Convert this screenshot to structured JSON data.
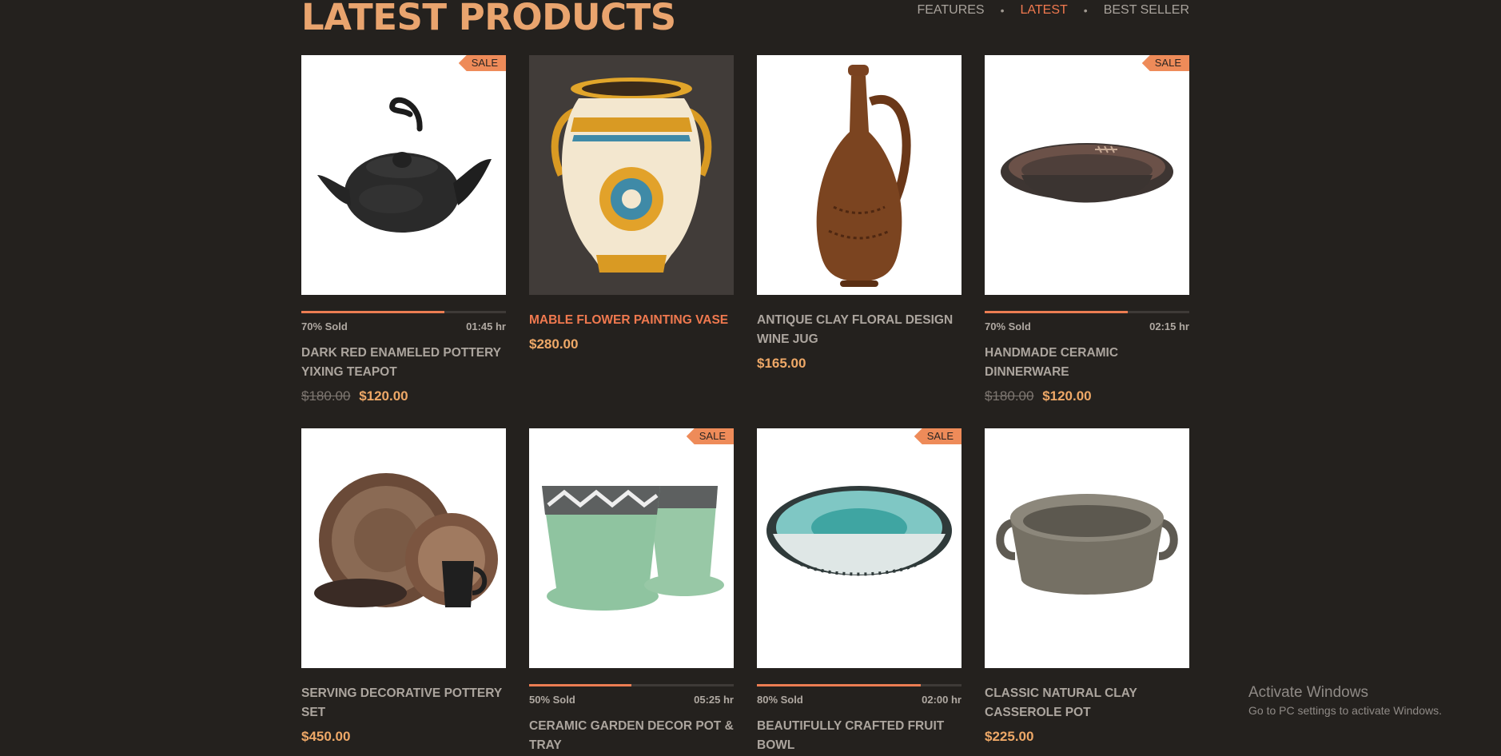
{
  "section": {
    "title": "LATEST PRODUCTS"
  },
  "tabs": [
    {
      "label": "FEATURES"
    },
    {
      "label": "LATEST"
    },
    {
      "label": "BEST SELLER"
    }
  ],
  "products": [
    {
      "name": "DARK RED ENAMELED POTTERY YIXING TEAPOT",
      "old_price": "$180.00",
      "price": "$120.00",
      "badge": "SALE",
      "sold_text": "70% Sold",
      "sold_percent": 70,
      "time_left": "01:45 hr",
      "image": "black-teapot"
    },
    {
      "name": "MABLE FLOWER PAINTING VASE",
      "price": "$280.00",
      "image": "painted-vase"
    },
    {
      "name": "ANTIQUE CLAY FLORAL DESIGN WINE JUG",
      "price": "$165.00",
      "image": "clay-wine-jug"
    },
    {
      "name": "HANDMADE CERAMIC DINNERWARE",
      "old_price": "$180.00",
      "price": "$120.00",
      "badge": "SALE",
      "sold_text": "70% Sold",
      "sold_percent": 70,
      "time_left": "02:15 hr",
      "image": "ceramic-dish"
    },
    {
      "name": "SERVING DECORATIVE POTTERY SET",
      "price": "$450.00",
      "image": "pottery-set"
    },
    {
      "name": "CERAMIC GARDEN DECOR POT & TRAY",
      "badge": "SALE",
      "sold_text": "50% Sold",
      "sold_percent": 50,
      "time_left": "05:25 hr",
      "image": "garden-pots"
    },
    {
      "name": "BEAUTIFULLY CRAFTED FRUIT BOWL",
      "badge": "SALE",
      "sold_text": "80% Sold",
      "sold_percent": 80,
      "time_left": "02:00 hr",
      "image": "fruit-bowl"
    },
    {
      "name": "CLASSIC NATURAL CLAY CASSEROLE POT",
      "price": "$225.00",
      "image": "casserole-pot"
    }
  ],
  "watermark": {
    "title": "Activate Windows",
    "subtitle": "Go to PC settings to activate Windows."
  },
  "colors": {
    "background": "#24211e",
    "title": "#e9a46e",
    "accent": "#f0794f",
    "price": "#eea867",
    "badge": "#ee8b59"
  }
}
